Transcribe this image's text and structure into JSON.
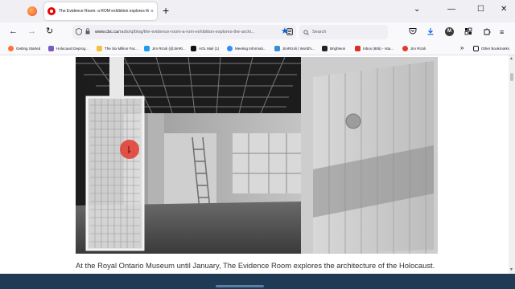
{
  "browser": {
    "tab_title": "The Evidence Room: a ROM exhibition explores the architecture of the Holocaust",
    "tab_close": "×",
    "new_tab": "+",
    "window": {
      "minimize": "⌄",
      "restore": "—",
      "maximize": "☐",
      "close": "✕"
    },
    "nav": {
      "back": "←",
      "forward": "→",
      "reload": "↻"
    },
    "url": {
      "host": "www.cbc.ca",
      "path": "/radio/q/blog/the-evidence-room-a-rom-exhibition-explores-the-archi..."
    },
    "search_placeholder": "Search",
    "toolbar": {
      "profile_initial": "M",
      "account_initial": "M"
    }
  },
  "bookmarks": [
    {
      "label": "Getting Started",
      "color": "#ff7139"
    },
    {
      "label": "Holocaust Deprog...",
      "color": "#7a5bbd"
    },
    {
      "label": "The Six Million Fac...",
      "color": "#f3c23a"
    },
    {
      "label": "Jim Rizoli (@JimRi...",
      "color": "#1d9bf0"
    },
    {
      "label": "AOL Mail (1)",
      "color": "#111111"
    },
    {
      "label": "Meeting Informati...",
      "color": "#2d8cff"
    },
    {
      "label": "JimRizoli | World's...",
      "color": "#3a8cd6"
    },
    {
      "label": "Brighteon",
      "color": "#222222"
    },
    {
      "label": "Inbox (855) - rsta...",
      "color": "#d93025"
    },
    {
      "label": "Jim Rizoli",
      "color": "#e23b2e"
    }
  ],
  "bookmarks_overflow": "»",
  "other_bookmarks": "Other Bookmarks",
  "article": {
    "caption": "At the Royal Ontario Museum until January, The Evidence Room explores the architecture of the Holocaust."
  },
  "colors": {
    "accent": "#0061e0",
    "cbc_red": "#e60505",
    "taskbar": "#1f3a55"
  }
}
